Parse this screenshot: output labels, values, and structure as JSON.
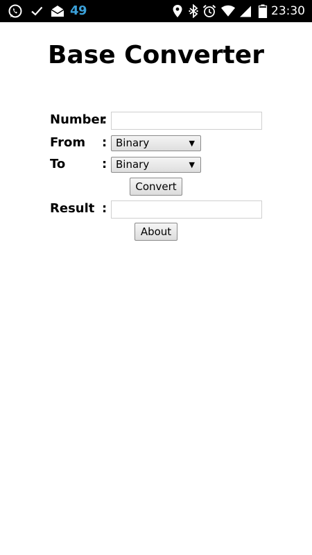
{
  "status_bar": {
    "notification_count": "49",
    "time": "23:30",
    "left_icons": [
      "whatsapp-icon",
      "check-icon",
      "mail-icon"
    ],
    "right_icons": [
      "location-icon",
      "bluetooth-icon",
      "alarm-icon",
      "wifi-icon",
      "signal-icon",
      "battery-icon"
    ],
    "count_color": "#3ba0d8"
  },
  "page": {
    "title": "Base Converter"
  },
  "form": {
    "number": {
      "label": "Number",
      "colon": ":",
      "value": ""
    },
    "from": {
      "label": "From",
      "colon": ":",
      "selected": "Binary"
    },
    "to": {
      "label": "To",
      "colon": ":",
      "selected": "Binary"
    },
    "convert_label": "Convert",
    "result": {
      "label": "Result",
      "colon": ":",
      "value": ""
    },
    "about_label": "About"
  }
}
